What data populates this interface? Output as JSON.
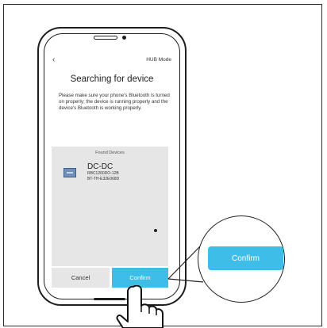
{
  "header": {
    "back_icon": "chevron-left-icon",
    "mode": "HUB Mode"
  },
  "title": "Searching for device",
  "description": "Please make sure your phone's Bluetooth is turned on properly; the device is running properly and the device's Bluetooth is working properly.",
  "found_devices": {
    "title": "Found Devices",
    "items": [
      {
        "name": "DC-DC",
        "model": "RBC1260DO-12B",
        "id": "BT-TH-E32E068D",
        "icon": "battery-device-icon"
      }
    ]
  },
  "buttons": {
    "cancel": "Cancel",
    "confirm": "Confirm"
  },
  "callout": {
    "confirm": "Confirm"
  },
  "colors": {
    "accent": "#3fbde9",
    "panel": "#e6e6e6"
  }
}
